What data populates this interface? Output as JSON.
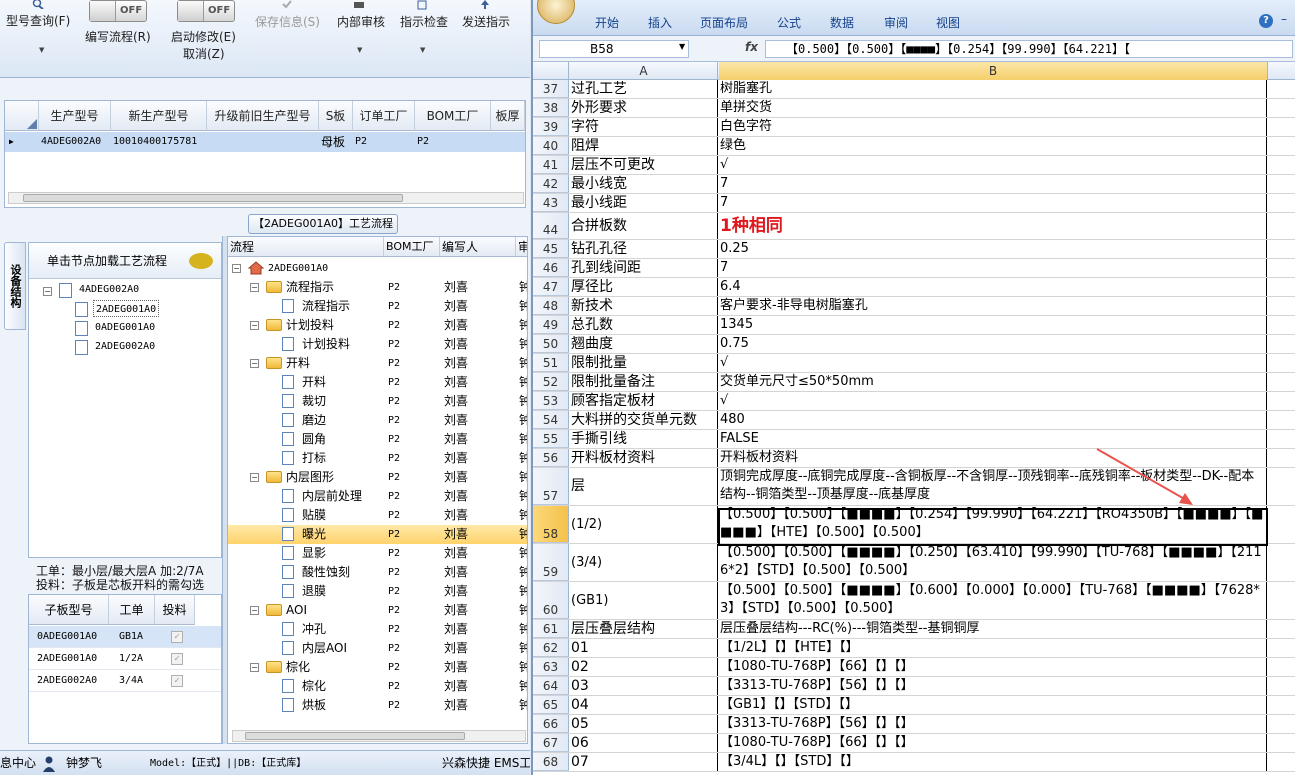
{
  "left": {
    "ribbon": {
      "buttons": [
        {
          "label": "型号查询(F)"
        },
        {
          "label": "编写流程(R)"
        },
        {
          "label": "启动修改(E)"
        },
        {
          "label": "取消(Z)"
        },
        {
          "label": "保存信息(S)"
        },
        {
          "label": "内部审核"
        },
        {
          "label": "指示检查"
        },
        {
          "label": "发送指示"
        }
      ],
      "toggle_off": "OFF"
    },
    "top_grid": {
      "headers": [
        "生产型号",
        "新生产型号",
        "升级前旧生产型号",
        "S板",
        "订单工厂",
        "BOM工厂",
        "板厚"
      ],
      "rows": [
        {
          "生产型号": "4ADEG002A0",
          "新生产型号": "10010400175781",
          "升级前旧生产型号": "",
          "S板": "母板",
          "订单工厂": "P2",
          "BOM工厂": "P2",
          "板厚": ""
        }
      ]
    },
    "workflow_title": "【2ADEG001A0】工艺流程",
    "side_tab": "设备结构",
    "tree_panel": {
      "header": "单击节点加载工艺流程",
      "root": "4ADEG002A0",
      "children": [
        "2ADEG001A0",
        "0ADEG001A0",
        "2ADEG002A0"
      ],
      "selected": "2ADEG001A0"
    },
    "info": {
      "line1": "工单：最小层/最大层A 加:2/7A",
      "line2": "投料：子板是芯板开料的需勾选"
    },
    "sub_grid": {
      "headers": [
        "子板型号",
        "工单",
        "投料"
      ],
      "rows": [
        {
          "model": "0ADEG001A0",
          "order": "GB1A",
          "checked": true
        },
        {
          "model": "2ADEG001A0",
          "order": "1/2A",
          "checked": true
        },
        {
          "model": "2ADEG002A0",
          "order": "3/4A",
          "checked": true
        }
      ]
    },
    "flow_grid": {
      "headers": [
        "流程",
        "BOM工厂",
        "编写人",
        "审"
      ],
      "root": "2ADEG001A0",
      "rows": [
        {
          "name": "流程指示",
          "level": 1,
          "type": "folder",
          "factory": "P2",
          "author": "刘喜",
          "more": "钟"
        },
        {
          "name": "流程指示",
          "level": 2,
          "type": "doc",
          "factory": "P2",
          "author": "刘喜",
          "more": "钟"
        },
        {
          "name": "计划投料",
          "level": 1,
          "type": "folder",
          "factory": "P2",
          "author": "刘喜",
          "more": "钟"
        },
        {
          "name": "计划投料",
          "level": 2,
          "type": "doc",
          "factory": "P2",
          "author": "刘喜",
          "more": "钟"
        },
        {
          "name": "开料",
          "level": 1,
          "type": "folder",
          "factory": "P2",
          "author": "刘喜",
          "more": "钟"
        },
        {
          "name": "开料",
          "level": 2,
          "type": "doc",
          "factory": "P2",
          "author": "刘喜",
          "more": "钟"
        },
        {
          "name": "裁切",
          "level": 2,
          "type": "doc",
          "factory": "P2",
          "author": "刘喜",
          "more": "钟"
        },
        {
          "name": "磨边",
          "level": 2,
          "type": "doc",
          "factory": "P2",
          "author": "刘喜",
          "more": "钟"
        },
        {
          "name": "圆角",
          "level": 2,
          "type": "doc",
          "factory": "P2",
          "author": "刘喜",
          "more": "钟"
        },
        {
          "name": "打标",
          "level": 2,
          "type": "doc",
          "factory": "P2",
          "author": "刘喜",
          "more": "钟"
        },
        {
          "name": "内层图形",
          "level": 1,
          "type": "folder",
          "factory": "P2",
          "author": "刘喜",
          "more": "钟"
        },
        {
          "name": "内层前处理",
          "level": 2,
          "type": "doc",
          "factory": "P2",
          "author": "刘喜",
          "more": "钟"
        },
        {
          "name": "贴膜",
          "level": 2,
          "type": "doc",
          "factory": "P2",
          "author": "刘喜",
          "more": "钟"
        },
        {
          "name": "曝光",
          "level": 2,
          "type": "doc",
          "factory": "P2",
          "author": "刘喜",
          "more": "钟",
          "selected": true
        },
        {
          "name": "显影",
          "level": 2,
          "type": "doc",
          "factory": "P2",
          "author": "刘喜",
          "more": "钟"
        },
        {
          "name": "酸性蚀刻",
          "level": 2,
          "type": "doc",
          "factory": "P2",
          "author": "刘喜",
          "more": "钟"
        },
        {
          "name": "退膜",
          "level": 2,
          "type": "doc",
          "factory": "P2",
          "author": "刘喜",
          "more": "钟"
        },
        {
          "name": "AOI",
          "level": 1,
          "type": "folder",
          "factory": "P2",
          "author": "刘喜",
          "more": "钟"
        },
        {
          "name": "冲孔",
          "level": 2,
          "type": "doc",
          "factory": "P2",
          "author": "刘喜",
          "more": "钟"
        },
        {
          "name": "内层AOI",
          "level": 2,
          "type": "doc",
          "factory": "P2",
          "author": "刘喜",
          "more": "钟"
        },
        {
          "name": "棕化",
          "level": 1,
          "type": "folder",
          "factory": "P2",
          "author": "刘喜",
          "more": "钟"
        },
        {
          "name": "棕化",
          "level": 2,
          "type": "doc",
          "factory": "P2",
          "author": "刘喜",
          "more": "钟"
        },
        {
          "name": "烘板",
          "level": 2,
          "type": "doc",
          "factory": "P2",
          "author": "刘喜",
          "more": "钟"
        }
      ]
    },
    "status": {
      "center": "息中心",
      "user": "钟梦飞",
      "model_db": "Model:【正式】||DB:【正式库】",
      "company": "兴森快捷 EMS工"
    }
  },
  "excel": {
    "tabs": [
      "开始",
      "插入",
      "页面布局",
      "公式",
      "数据",
      "审阅",
      "视图"
    ],
    "name_box": "B58",
    "formula": "【0.500】【0.500】【■■■■】【0.254】【99.990】【64.221】【",
    "columns": [
      "A",
      "B"
    ],
    "rows": [
      {
        "n": "37",
        "a": "过孔工艺",
        "b": "树脂塞孔"
      },
      {
        "n": "38",
        "a": "外形要求",
        "b": "单拼交货"
      },
      {
        "n": "39",
        "a": "字符",
        "b": "白色字符"
      },
      {
        "n": "40",
        "a": "阻焊",
        "b": "绿色"
      },
      {
        "n": "41",
        "a": "层压不可更改",
        "b": "√"
      },
      {
        "n": "42",
        "a": "最小线宽",
        "b": "7"
      },
      {
        "n": "43",
        "a": "最小线距",
        "b": "7"
      },
      {
        "n": "44",
        "a": "合拼板数",
        "b": "1种相同",
        "big": true
      },
      {
        "n": "45",
        "a": "钻孔孔径",
        "b": "0.25"
      },
      {
        "n": "46",
        "a": "孔到线间距",
        "b": "7"
      },
      {
        "n": "47",
        "a": "厚径比",
        "b": "6.4"
      },
      {
        "n": "48",
        "a": "新技术",
        "b": "客户要求-非导电树脂塞孔"
      },
      {
        "n": "49",
        "a": "总孔数",
        "b": "1345"
      },
      {
        "n": "50",
        "a": "翘曲度",
        "b": "0.75"
      },
      {
        "n": "51",
        "a": "限制批量",
        "b": "√"
      },
      {
        "n": "52",
        "a": "限制批量备注",
        "b": "交货单元尺寸≤50*50mm"
      },
      {
        "n": "53",
        "a": "顾客指定板材",
        "b": "√"
      },
      {
        "n": "54",
        "a": "大料拼的交货单元数",
        "b": "480"
      },
      {
        "n": "55",
        "a": "手撕引线",
        "b": "FALSE"
      },
      {
        "n": "56",
        "a": "开料板材资料",
        "b": "开料板材资料"
      },
      {
        "n": "57",
        "a": "层",
        "b": "顶铜完成厚度--底铜完成厚度--含铜板厚--不含铜厚--顶残铜率--底残铜率--板材类型--DK--配本结构--铜箔类型--顶基厚度--底基厚度",
        "tall": true
      },
      {
        "n": "58",
        "a": "(1/2)",
        "b": "【0.500】【0.500】【■■■■】【0.254】【99.990】【64.221】【RO4350B】【■■■■】【■■■■】【HTE】【0.500】【0.500】",
        "tall": true,
        "selected": true
      },
      {
        "n": "59",
        "a": "(3/4)",
        "b": "【0.500】【0.500】【■■■■】【0.250】【63.410】【99.990】【TU-768】【■■■■】【2116*2】【STD】【0.500】【0.500】",
        "tall": true
      },
      {
        "n": "60",
        "a": "(GB1)",
        "b": "【0.500】【0.500】【■■■■】【0.600】【0.000】【0.000】【TU-768】【■■■■】【7628*3】【STD】【0.500】【0.500】",
        "tall": true
      },
      {
        "n": "61",
        "a": "层压叠层结构",
        "b": "层压叠层结构---RC(%)---铜箔类型--基铜铜厚"
      },
      {
        "n": "62",
        "a": "01",
        "b": "【1/2L】【】【HTE】【】"
      },
      {
        "n": "63",
        "a": "02",
        "b": "【1080-TU-768P】【66】【】【】"
      },
      {
        "n": "64",
        "a": "03",
        "b": "【3313-TU-768P】【56】【】【】"
      },
      {
        "n": "65",
        "a": "04",
        "b": "【GB1】【】【STD】【】"
      },
      {
        "n": "66",
        "a": "05",
        "b": "【3313-TU-768P】【56】【】【】"
      },
      {
        "n": "67",
        "a": "06",
        "b": "【1080-TU-768P】【66】【】【】"
      },
      {
        "n": "68",
        "a": "07",
        "b": "【3/4L】【】【STD】【】"
      }
    ]
  },
  "colors": {
    "selection": "#ffd36b",
    "accent_red": "#e0181d",
    "ribbon": "#dce7f5"
  }
}
